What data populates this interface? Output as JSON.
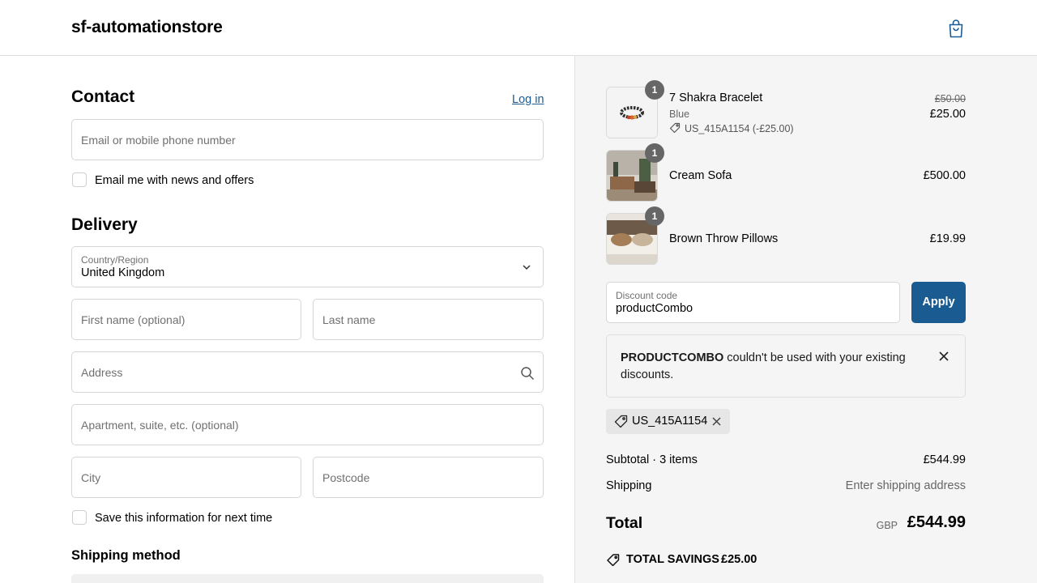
{
  "header": {
    "store_name": "sf-automationstore",
    "cart_icon": "shopping-bag-icon"
  },
  "contact": {
    "title": "Contact",
    "login_link": "Log in",
    "email_placeholder": "Email or mobile phone number",
    "news_checkbox_label": "Email me with news and offers"
  },
  "delivery": {
    "title": "Delivery",
    "country_label": "Country/Region",
    "country_value": "United Kingdom",
    "first_name_placeholder": "First name (optional)",
    "last_name_placeholder": "Last name",
    "address_placeholder": "Address",
    "apartment_placeholder": "Apartment, suite, etc. (optional)",
    "city_placeholder": "City",
    "postcode_placeholder": "Postcode",
    "save_info_label": "Save this information for next time"
  },
  "shipping_method": {
    "title": "Shipping method"
  },
  "cart": {
    "items": [
      {
        "name": "7 Shakra Bracelet",
        "variant": "Blue",
        "discount": "US_415A1154 (-£25.00)",
        "original_price": "£50.00",
        "price": "£25.00",
        "quantity": "1"
      },
      {
        "name": "Cream Sofa",
        "price": "£500.00",
        "quantity": "1"
      },
      {
        "name": "Brown Throw Pillows",
        "price": "£19.99",
        "quantity": "1"
      }
    ],
    "discount_label": "Discount code",
    "discount_value": "productCombo",
    "apply_button": "Apply",
    "error_code": "PRODUCTCOMBO",
    "error_message": " couldn't be used with your existing discounts.",
    "applied_code": "US_415A1154",
    "subtotal_label": "Subtotal · 3 items",
    "subtotal_value": "£544.99",
    "shipping_label": "Shipping",
    "shipping_value": "Enter shipping address",
    "total_label": "Total",
    "total_currency": "GBP",
    "total_value": "£544.99",
    "savings_label": "TOTAL SAVINGS",
    "savings_value": "£25.00"
  },
  "colors": {
    "accent": "#1a5b91",
    "link": "#1c5b94",
    "panel_bg": "#f5f5f5"
  }
}
